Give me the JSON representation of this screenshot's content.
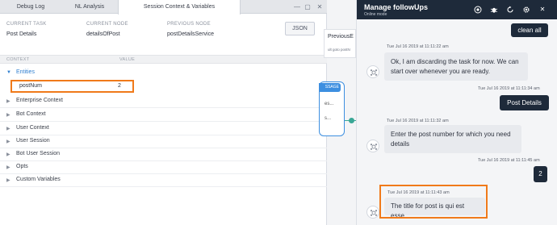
{
  "tabs": {
    "debug_log": "Debug Log",
    "nl_analysis": "NL Analysis",
    "session_context": "Session Context & Variables"
  },
  "info": {
    "current_task_label": "CURRENT TASK",
    "current_task_value": "Post Details",
    "current_node_label": "CURRENT NODE",
    "current_node_value": "detailsOfPost",
    "previous_node_label": "PREVIOUS NODE",
    "previous_node_value": "postDetailsService",
    "json_button": "JSON"
  },
  "grid": {
    "col_context": "CONTEXT",
    "col_value": "VALUE"
  },
  "contexts": {
    "entities": "Entities",
    "entity_key": "postNum",
    "entity_value": "2",
    "enterprise": "Enterprise Context",
    "bot": "Bot Context",
    "user": "User Context",
    "user_session": "User Session",
    "bot_user_session": "Bot User Session",
    "opts": "Opts",
    "custom_variables": "Custom Variables"
  },
  "canvas": {
    "card_title": "PreviousE",
    "card_sub": "ult goto postN",
    "node_tag": "SSAGE",
    "node_line1": "es...",
    "node_line2": "s..."
  },
  "chat": {
    "title": "Manage followUps",
    "status": "Online mode",
    "messages": {
      "m1_text": "clean all",
      "m2_time": "Tue Jul 16 2019 at 11:11:22 am",
      "m2_text": "Ok, I am discarding the task for now. We can start over whenever you are ready.",
      "m3_time": "Tue Jul 16 2019 at 11:11:34 am",
      "m3_text": "Post Details",
      "m4_time": "Tue Jul 16 2019 at 11:11:32 am",
      "m4_text": "Enter the post number for which you need details",
      "m5_time": "Tue Jul 16 2019 at 11:11:45 am",
      "m5_text": "2",
      "m6_time": "Tue Jul 16 2019 at 11:11:43 am",
      "m6_text": "The title for post is qui est esse"
    }
  },
  "colors": {
    "highlight": "#f07a1a",
    "chat_header": "#1e2a3a",
    "link_blue": "#2f7fd0"
  }
}
